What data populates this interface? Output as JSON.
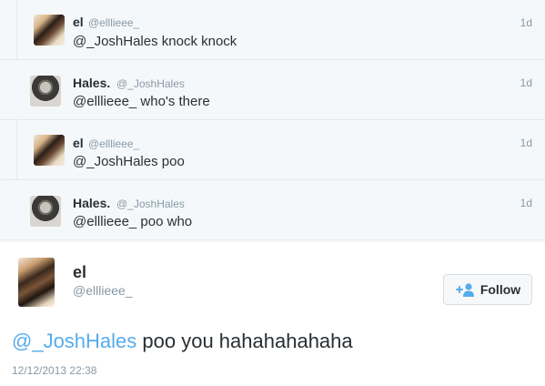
{
  "replies": [
    {
      "name": "el",
      "handle": "@elllieee_",
      "time": "1d",
      "text": "@_JoshHales knock knock",
      "avatar": "el-avatar"
    },
    {
      "name": "Hales.",
      "handle": "@_JoshHales",
      "time": "1d",
      "text": "@elllieee_ who's there",
      "avatar": "hales-avatar"
    },
    {
      "name": "el",
      "handle": "@elllieee_",
      "time": "1d",
      "text": "@_JoshHales poo",
      "avatar": "el-avatar"
    },
    {
      "name": "Hales.",
      "handle": "@_JoshHales",
      "time": "1d",
      "text": "@elllieee_ poo who",
      "avatar": "hales-avatar"
    }
  ],
  "main_tweet": {
    "name": "el",
    "handle": "@elllieee_",
    "follow_label": "Follow",
    "follow_icon": "add-user-icon",
    "mention": "@_JoshHales",
    "text": " poo you hahahahahaha",
    "date": "12/12/2013 22:38"
  },
  "colors": {
    "accent": "#55acee",
    "text": "#292f33",
    "muted": "#8899a6",
    "thread_bg": "#f5f8fa"
  }
}
